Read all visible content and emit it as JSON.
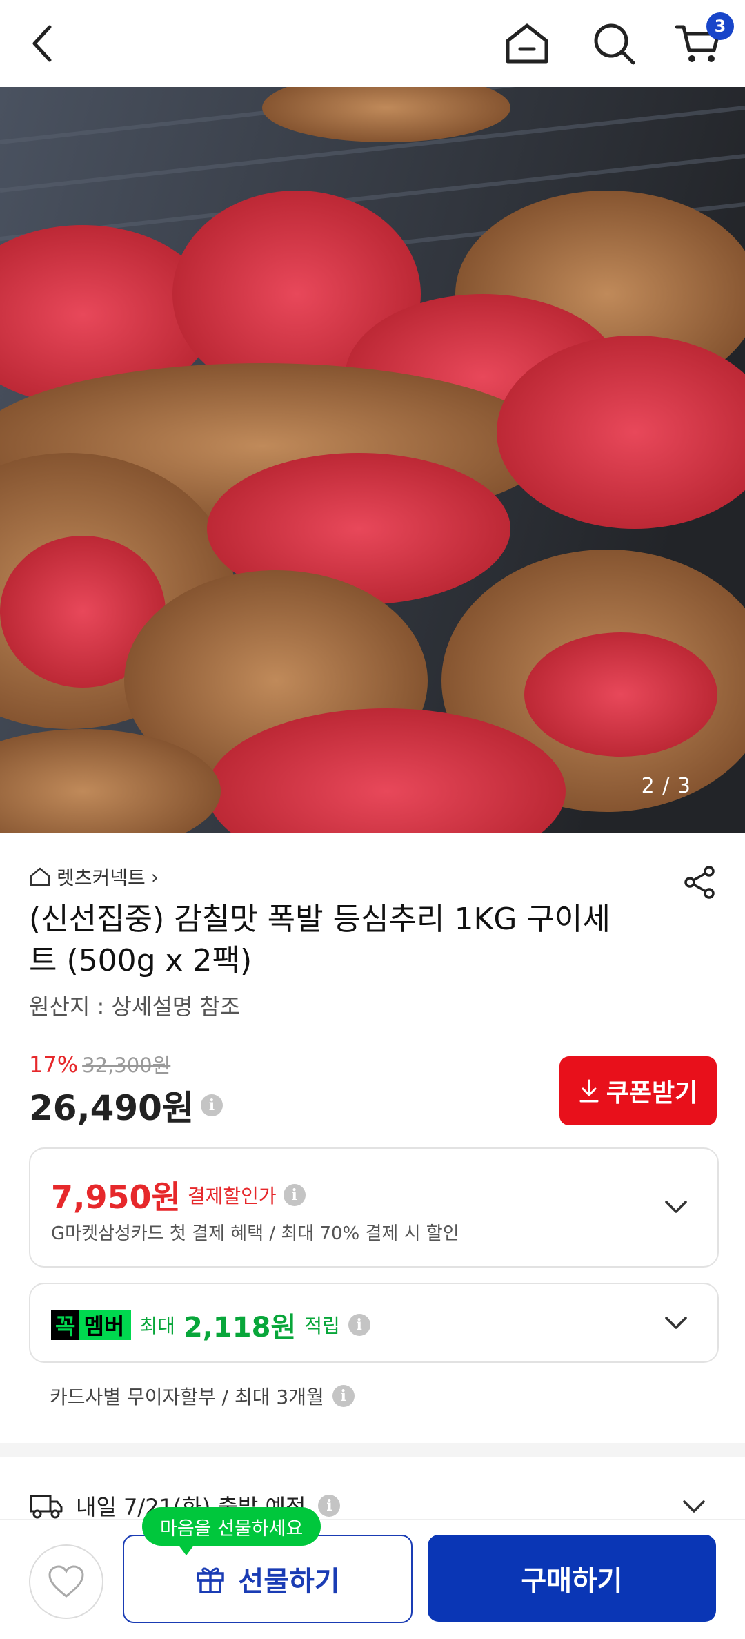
{
  "header": {
    "back_icon": "chevron-left-icon",
    "home_icon": "home-icon",
    "search_icon": "search-icon",
    "cart_icon": "cart-icon",
    "cart_count": "3"
  },
  "gallery": {
    "counter": "2 / 3"
  },
  "product": {
    "shop_name": "렛츠커넥트",
    "shop_chevron": "›",
    "title": "(신선집중) 감칠맛 폭발 등심추리 1KG 구이세트 (500g x 2팩)",
    "origin": "원산지 : 상세설명 참조",
    "discount_rate": "17%",
    "original_price": "32,300원",
    "price": "26,490원",
    "info_mark": "i",
    "coupon_label": "쿠폰받기"
  },
  "payment_discount": {
    "amount": "7,950원",
    "label": "결제할인가",
    "description": "G마켓삼성카드 첫 결제 혜택 / 최대 70% 결제 시 할인"
  },
  "membership": {
    "logo_part1": "꼭",
    "logo_part2": "멤버",
    "prefix": "최대",
    "amount": "2,118원",
    "suffix": "적립"
  },
  "installment": {
    "text": "카드사별 무이자할부 / 최대 3개월"
  },
  "delivery": {
    "text": "내일 7/21(화) 출발 예정"
  },
  "bottom_bar": {
    "gift_tooltip": "마음을 선물하세요",
    "gift_label": "선물하기",
    "buy_label": "구매하기"
  },
  "colors": {
    "accent_red": "#e8101b",
    "brand_blue": "#0a36b5",
    "member_green": "#00d84f"
  }
}
